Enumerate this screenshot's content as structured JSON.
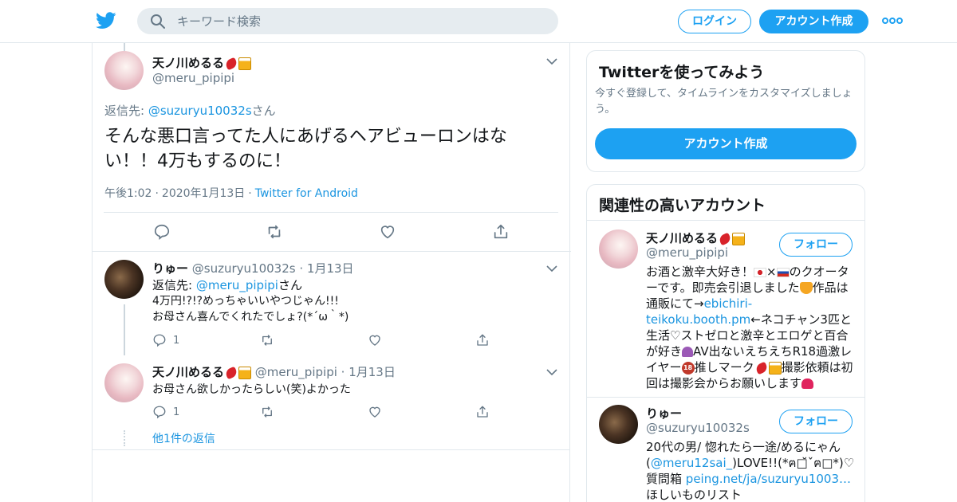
{
  "header": {
    "search_placeholder": "キーワード検索",
    "login_label": "ログイン",
    "signup_label": "アカウント作成"
  },
  "main_tweet": {
    "name": "天ノ川めるる",
    "handle": "@meru_pipipi",
    "reply_prefix": "返信先:",
    "reply_to": "@suzuryu10032s",
    "reply_suffix": "さん",
    "text": "そんな悪口言ってた人にあげるヘアビューロンはない！！4万もするのに！",
    "time": "午後1:02",
    "date": "2020年1月13日",
    "source": "Twitter for Android"
  },
  "replies": [
    {
      "name": "りゅー",
      "handle": "@suzuryu10032s",
      "date": "1月13日",
      "reply_prefix": "返信先:",
      "reply_to": "@meru_pipipi",
      "reply_suffix": "さん",
      "line1": "4万円!?!?めっちゃいいやつじゃん!!!",
      "line2": "お母さん喜んでくれたでしょ?(*´ω｀*)",
      "reply_count": "1"
    },
    {
      "name": "天ノ川めるる",
      "handle": "@meru_pipipi",
      "date": "1月13日",
      "line1": "お母さん欲しかったらしい(笑)よかった",
      "reply_count": "1"
    }
  ],
  "more_replies_label": "他1件の返信",
  "signup_card": {
    "title": "Twitterを使ってみよう",
    "subtitle": "今すぐ登録して、タイムラインをカスタマイズしましょう。",
    "button_label": "アカウント作成"
  },
  "related": {
    "title": "関連性の高いアカウント",
    "follow_label": "フォロー",
    "accounts": [
      {
        "name": "天ノ川めるる",
        "handle": "@meru_pipipi",
        "bio_1": "お酒と激辛大好き！",
        "bio_2": "のクオーターです。即売会引退しました",
        "bio_3": "作品は通販にて→",
        "bio_link": "ebichiri-teikoku.booth.pm",
        "bio_4": "←ネコチャン3匹と生活♡ストゼロと激辛とエロゲと百合が好き",
        "bio_5": "AV出ないえちえちR18過激レイヤー",
        "bio_6": "推しマーク",
        "bio_7": "撮影依頼は初回は撮影会からお願いします"
      },
      {
        "name": "りゅー",
        "handle": "@suzuryu10032s",
        "bio_1": "20代の男/ 惚れたら一途/めるにゃん(",
        "bio_mention": "@meru12sai_",
        "bio_2": ")LOVE!!(*ฅ□̆ˇฅ□*)♡ 質問箱",
        "bio_link": "peing.net/ja/suzuryu1003…",
        "bio_3": "ほしいものリスト"
      }
    ]
  }
}
